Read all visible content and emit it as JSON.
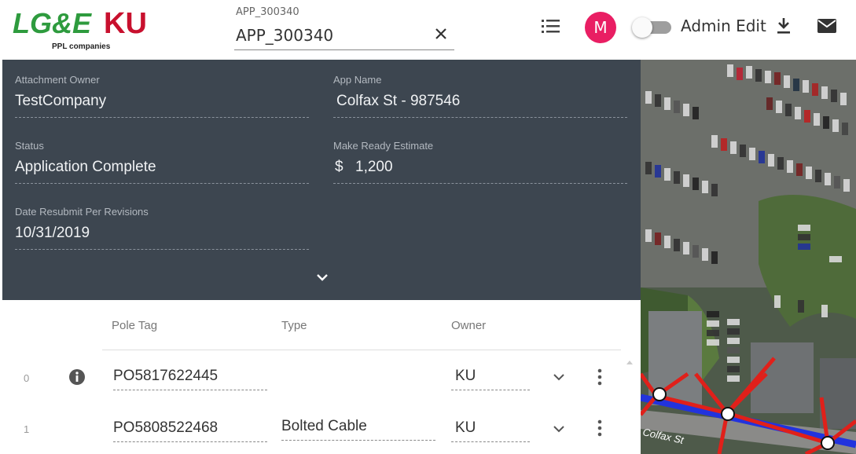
{
  "header": {
    "brand_left": "LG&E",
    "brand_right": "KU",
    "brand_sub": "PPL companies",
    "search": {
      "label": "APP_300340",
      "value": "APP_300340"
    },
    "avatar_initial": "M",
    "admin_edit_label": "Admin Edit",
    "colors": {
      "avatar": "#e91e63",
      "brand_green": "#2e9b3e",
      "brand_red": "#c8102e"
    }
  },
  "details": {
    "attachment_owner": {
      "label": "Attachment Owner",
      "value": "TestCompany"
    },
    "app_name": {
      "label": "App Name",
      "value": "Colfax St - 987546"
    },
    "status": {
      "label": "Status",
      "value": "Application Complete"
    },
    "make_ready": {
      "label": "Make Ready Estimate",
      "currency": "$",
      "value": "1,200"
    },
    "date_resubmit": {
      "label": "Date Resubmit Per Revisions",
      "value": "10/31/2019"
    },
    "colors": {
      "panel_bg": "#3d4650"
    }
  },
  "poles": {
    "columns": {
      "pole_tag": "Pole Tag",
      "type": "Type",
      "owner": "Owner"
    },
    "rows": [
      {
        "index": "0",
        "pole_tag": "PO5817622445",
        "type": "",
        "owner": "KU",
        "has_info": true
      },
      {
        "index": "1",
        "pole_tag": "PO5808522468",
        "type": "Bolted Cable",
        "owner": "KU",
        "has_info": false
      }
    ]
  },
  "map": {
    "street_label": "Colfax St",
    "colors": {
      "route_blue": "#2233dd",
      "line_red": "#e0201a"
    }
  }
}
